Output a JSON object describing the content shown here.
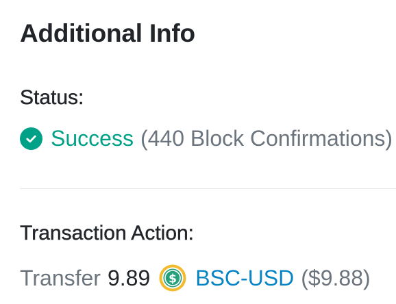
{
  "section": {
    "title": "Additional Info"
  },
  "status": {
    "label": "Status:",
    "value": "Success",
    "detail": "(440 Block Confirmations)",
    "icon": "check-circle-icon",
    "color": "#00a186"
  },
  "transaction_action": {
    "label": "Transaction Action:",
    "verb": "Transfer",
    "amount": "9.89",
    "token_icon": "dollar-coin-icon",
    "token_name": "BSC-USD",
    "usd_value": "($9.88)",
    "token_color": "#0784c3"
  }
}
